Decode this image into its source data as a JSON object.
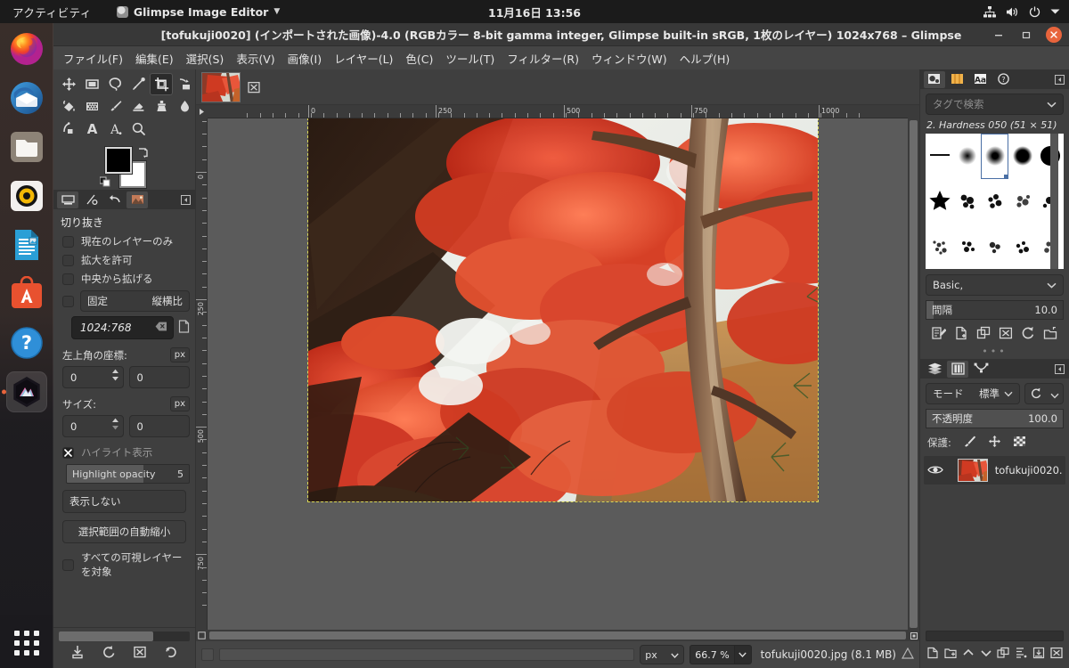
{
  "system_bar": {
    "activities": "アクティビティ",
    "app_name": "Glimpse Image Editor",
    "clock": "11月16日  13:56",
    "icons": [
      "network-icon",
      "volume-icon",
      "power-icon",
      "chevron-down-icon"
    ]
  },
  "dock": {
    "items": [
      {
        "name": "firefox",
        "label": "Firefox"
      },
      {
        "name": "thunderbird",
        "label": "Thunderbird"
      },
      {
        "name": "files",
        "label": "Files"
      },
      {
        "name": "rhythmbox",
        "label": "Rhythmbox"
      },
      {
        "name": "libreoffice-writer",
        "label": "LibreOffice Writer"
      },
      {
        "name": "ubuntu-software",
        "label": "Ubuntu Software"
      },
      {
        "name": "help",
        "label": "Help"
      },
      {
        "name": "glimpse",
        "label": "Glimpse Image Editor",
        "running": true
      }
    ],
    "show_apps": "Show Applications"
  },
  "window": {
    "title": "[tofukuji0020] (インポートされた画像)-4.0 (RGBカラー 8-bit gamma integer, Glimpse built-in sRGB, 1枚のレイヤー) 1024x768 – Glimpse",
    "controls": {
      "minimize": "–",
      "maximize": "□",
      "close": "✕"
    }
  },
  "menubar": [
    "ファイル(F)",
    "編集(E)",
    "選択(S)",
    "表示(V)",
    "画像(I)",
    "レイヤー(L)",
    "色(C)",
    "ツール(T)",
    "フィルター(R)",
    "ウィンドウ(W)",
    "ヘルプ(H)"
  ],
  "toolbox": {
    "tools": [
      {
        "name": "move-tool",
        "active": false
      },
      {
        "name": "rectangle-select-tool",
        "active": false
      },
      {
        "name": "free-select-tool",
        "active": false
      },
      {
        "name": "measure-tool",
        "active": false
      },
      {
        "name": "crop-tool",
        "active": true
      },
      {
        "name": "transform-tool",
        "active": false
      },
      {
        "name": "bucket-fill-tool",
        "active": false
      },
      {
        "name": "pattern-fill-tool",
        "active": false
      },
      {
        "name": "paintbrush-tool",
        "active": false
      },
      {
        "name": "eraser-tool",
        "active": false
      },
      {
        "name": "clone-tool",
        "active": false
      },
      {
        "name": "blur-tool",
        "active": false
      },
      {
        "name": "ink-tool",
        "active": false
      },
      {
        "name": "text-tool",
        "active": false
      },
      {
        "name": "text-path-tool",
        "active": false
      },
      {
        "name": "zoom-tool",
        "active": false
      }
    ],
    "foreground_color": "#000000",
    "background_color": "#ffffff"
  },
  "tool_options": {
    "tabs": [
      "tool-options-tab",
      "device-status-tab",
      "undo-history-tab",
      "images-tab"
    ],
    "title": "切り抜き",
    "checkboxes": [
      {
        "label": "現在のレイヤーのみ",
        "checked": false
      },
      {
        "label": "拡大を許可",
        "checked": false
      },
      {
        "label": "中央から拡げる",
        "checked": false
      }
    ],
    "fixed": {
      "label": "固定",
      "checked": false,
      "mode": "縦横比"
    },
    "aspect_ratio_value": "1024:768",
    "position": {
      "label": "左上角の座標:",
      "unit": "px",
      "x": "0",
      "y": "0"
    },
    "size": {
      "label": "サイズ:",
      "unit": "px",
      "w": "0",
      "h": "0"
    },
    "highlight": {
      "label": "ハイライト表示",
      "checked": true
    },
    "highlight_opacity": {
      "label": "Highlight opacity",
      "value": "5"
    },
    "guides": "表示しない",
    "auto_shrink_button": "選択範囲の自動縮小",
    "all_layers": {
      "label": "すべての可視レイヤーを対象",
      "checked": false
    },
    "footer_icons": [
      "save-tool-preset-icon",
      "restore-tool-preset-icon",
      "delete-tool-preset-icon",
      "reset-tool-options-icon"
    ]
  },
  "canvas": {
    "image_tab_name": "tofukuji0020.jpg",
    "close_tab_icon": "close-icon",
    "ruler_h_labels": [
      "0",
      "250",
      "500",
      "750",
      "1000"
    ],
    "ruler_v_labels": [
      "0",
      "250",
      "500",
      "750"
    ],
    "selection_style": "dashed-marching-ants"
  },
  "statusbar": {
    "unit": "px",
    "zoom": "66.7 %",
    "file_info": "tofukuji0020.jpg (8.1 MB)",
    "navigate_icon": "navigate-canvas-icon"
  },
  "brushes_panel": {
    "tabs": [
      "brushes-tab",
      "patterns-tab",
      "fonts-tab",
      "help-tab"
    ],
    "search_placeholder": "タグで検索",
    "selected_brush": "2. Hardness 050 (51 × 51)",
    "list_selector": "Basic,",
    "spacing": {
      "label": "間隔",
      "value": "10.0"
    },
    "action_icons": [
      "edit-brush-icon",
      "new-brush-icon",
      "duplicate-brush-icon",
      "delete-brush-icon",
      "refresh-brushes-icon",
      "open-brush-folder-icon"
    ]
  },
  "layers_panel": {
    "tabs": [
      "layers-tab",
      "channels-tab",
      "paths-tab"
    ],
    "mode": {
      "label": "モード",
      "value": "標準"
    },
    "opacity": {
      "label": "不透明度",
      "value": "100.0"
    },
    "lock": {
      "label": "保護:",
      "icons": [
        "lock-pixels-icon",
        "lock-position-icon",
        "lock-alpha-icon"
      ]
    },
    "layers": [
      {
        "name": "tofukuji0020.",
        "visible": true
      }
    ],
    "bottom_icons": [
      "new-layer-icon",
      "new-group-icon",
      "raise-layer-icon",
      "lower-layer-icon",
      "duplicate-layer-icon",
      "anchor-layer-icon",
      "merge-down-icon",
      "delete-layer-icon"
    ]
  },
  "colors": {
    "accent_close": "#e8643c",
    "panel_bg": "#3f3f3f",
    "canvas_bg": "#5b5b5b",
    "titlebar_bg": "#383838",
    "selection": "#d8d85a"
  }
}
